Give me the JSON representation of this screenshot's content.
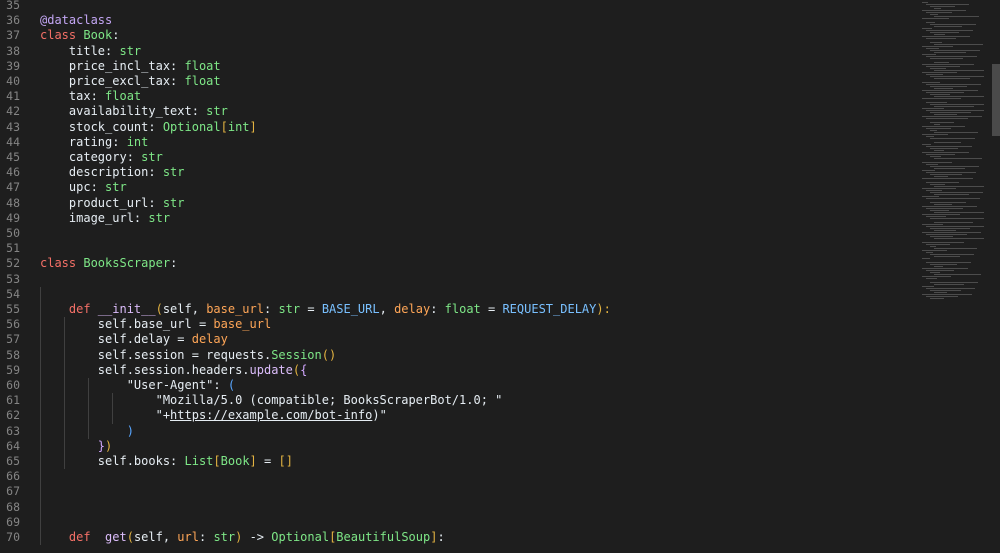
{
  "editor": {
    "line_numbers": [
      "35",
      "36",
      "37",
      "38",
      "39",
      "40",
      "41",
      "42",
      "43",
      "44",
      "45",
      "46",
      "47",
      "48",
      "49",
      "50",
      "51",
      "52",
      "53",
      "54",
      "55",
      "56",
      "57",
      "58",
      "59",
      "60",
      "61",
      "62",
      "63",
      "64",
      "65",
      "66",
      "67",
      "68",
      "69",
      "70"
    ],
    "lines": [
      [],
      [
        {
          "t": "@dataclass",
          "c": "deco"
        }
      ],
      [
        {
          "t": "class ",
          "c": "kw"
        },
        {
          "t": "Book",
          "c": "cls"
        },
        {
          "t": ":",
          "c": "op"
        }
      ],
      [
        {
          "t": "    title: ",
          "c": "prop"
        },
        {
          "t": "str",
          "c": "type2"
        }
      ],
      [
        {
          "t": "    price_incl_tax: ",
          "c": "prop"
        },
        {
          "t": "float",
          "c": "type2"
        }
      ],
      [
        {
          "t": "    price_excl_tax: ",
          "c": "prop"
        },
        {
          "t": "float",
          "c": "type2"
        }
      ],
      [
        {
          "t": "    tax: ",
          "c": "prop"
        },
        {
          "t": "float",
          "c": "type2"
        }
      ],
      [
        {
          "t": "    availability_text: ",
          "c": "prop"
        },
        {
          "t": "str",
          "c": "type2"
        }
      ],
      [
        {
          "t": "    stock_count: ",
          "c": "prop"
        },
        {
          "t": "Optional",
          "c": "type2"
        },
        {
          "t": "[",
          "c": "br1"
        },
        {
          "t": "int",
          "c": "type2"
        },
        {
          "t": "]",
          "c": "br1"
        }
      ],
      [
        {
          "t": "    rating: ",
          "c": "prop"
        },
        {
          "t": "int",
          "c": "type2"
        }
      ],
      [
        {
          "t": "    category: ",
          "c": "prop"
        },
        {
          "t": "str",
          "c": "type2"
        }
      ],
      [
        {
          "t": "    description: ",
          "c": "prop"
        },
        {
          "t": "str",
          "c": "type2"
        }
      ],
      [
        {
          "t": "    upc: ",
          "c": "prop"
        },
        {
          "t": "str",
          "c": "type2"
        }
      ],
      [
        {
          "t": "    product_url: ",
          "c": "prop"
        },
        {
          "t": "str",
          "c": "type2"
        }
      ],
      [
        {
          "t": "    image_url: ",
          "c": "prop"
        },
        {
          "t": "str",
          "c": "type2"
        }
      ],
      [],
      [],
      [
        {
          "t": "class ",
          "c": "kw"
        },
        {
          "t": "BooksScraper",
          "c": "cls"
        },
        {
          "t": ":",
          "c": "op"
        }
      ],
      [],
      [],
      [
        {
          "t": "    def ",
          "c": "def"
        },
        {
          "t": "__init__",
          "c": "fn"
        },
        {
          "t": "(",
          "c": "br1"
        },
        {
          "t": "self, ",
          "c": "prop"
        },
        {
          "t": "base_url",
          "c": "param"
        },
        {
          "t": ": ",
          "c": "op"
        },
        {
          "t": "str",
          "c": "type2"
        },
        {
          "t": " = ",
          "c": "op"
        },
        {
          "t": "BASE_URL",
          "c": "const"
        },
        {
          "t": ", ",
          "c": "op"
        },
        {
          "t": "delay",
          "c": "param"
        },
        {
          "t": ": ",
          "c": "op"
        },
        {
          "t": "float",
          "c": "type2"
        },
        {
          "t": " = ",
          "c": "op"
        },
        {
          "t": "REQUEST_DELAY",
          "c": "const"
        },
        {
          "t": "):",
          "c": "br1"
        }
      ],
      [
        {
          "t": "        self.base_url = ",
          "c": "prop"
        },
        {
          "t": "base_url",
          "c": "param"
        }
      ],
      [
        {
          "t": "        self.delay = ",
          "c": "prop"
        },
        {
          "t": "delay",
          "c": "param"
        }
      ],
      [
        {
          "t": "        self.session = requests.",
          "c": "prop"
        },
        {
          "t": "Session",
          "c": "type2"
        },
        {
          "t": "()",
          "c": "br1"
        }
      ],
      [
        {
          "t": "        self.session.headers.",
          "c": "prop"
        },
        {
          "t": "update",
          "c": "fn"
        },
        {
          "t": "(",
          "c": "br1"
        },
        {
          "t": "{",
          "c": "br2"
        }
      ],
      [
        {
          "t": "            \"User-Agent\"",
          "c": "str"
        },
        {
          "t": ": ",
          "c": "op"
        },
        {
          "t": "(",
          "c": "br3"
        }
      ],
      [
        {
          "t": "                \"Mozilla/5.0 (compatible; BooksScraperBot/1.0; \"",
          "c": "str"
        }
      ],
      [
        {
          "t": "                \"+",
          "c": "str"
        },
        {
          "t": "https://example.com/bot-info",
          "c": "str link"
        },
        {
          "t": ")\"",
          "c": "str"
        }
      ],
      [
        {
          "t": "            ",
          "c": "op"
        },
        {
          "t": ")",
          "c": "br3"
        }
      ],
      [
        {
          "t": "        ",
          "c": "op"
        },
        {
          "t": "}",
          "c": "br2"
        },
        {
          "t": ")",
          "c": "br1"
        }
      ],
      [
        {
          "t": "        self.books: ",
          "c": "prop"
        },
        {
          "t": "List",
          "c": "type2"
        },
        {
          "t": "[",
          "c": "br1"
        },
        {
          "t": "Book",
          "c": "type2"
        },
        {
          "t": "]",
          "c": "br1"
        },
        {
          "t": " = ",
          "c": "op"
        },
        {
          "t": "[]",
          "c": "br1"
        }
      ],
      [],
      [],
      [],
      [],
      [
        {
          "t": "    def ",
          "c": "def"
        },
        {
          "t": " get",
          "c": "fn"
        },
        {
          "t": "(",
          "c": "br1"
        },
        {
          "t": "self, ",
          "c": "prop"
        },
        {
          "t": "url",
          "c": "param"
        },
        {
          "t": ": ",
          "c": "op"
        },
        {
          "t": "str",
          "c": "type2"
        },
        {
          "t": ")",
          "c": "br1"
        },
        {
          "t": " -> ",
          "c": "op"
        },
        {
          "t": "Optional",
          "c": "type2"
        },
        {
          "t": "[",
          "c": "br1"
        },
        {
          "t": "BeautifulSoup",
          "c": "type2"
        },
        {
          "t": "]",
          "c": "br1"
        },
        {
          "t": ":",
          "c": "op"
        }
      ]
    ]
  }
}
